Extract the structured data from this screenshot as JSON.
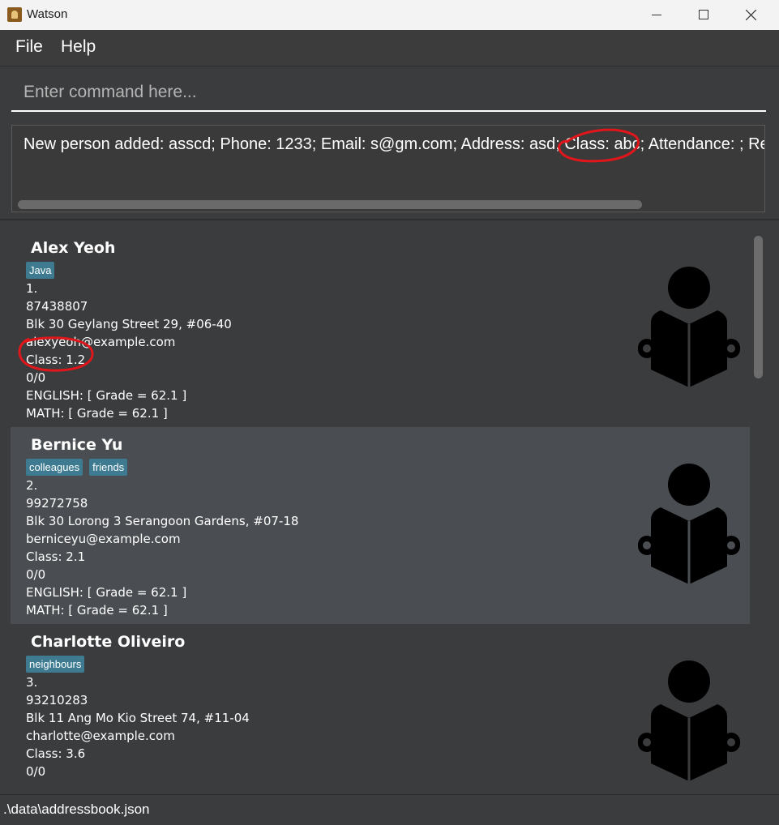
{
  "window": {
    "title": "Watson"
  },
  "menu": {
    "file": "File",
    "help": "Help"
  },
  "command": {
    "placeholder": "Enter command here...",
    "value": ""
  },
  "result": {
    "text": "New person added: asscd; Phone: 1233; Email: s@gm.com; Address: asd; Class: abc; Attendance: ; Remarks"
  },
  "persons": [
    {
      "name": "Alex Yeoh",
      "tags": [
        "Java"
      ],
      "index": "1.",
      "phone": "87438807",
      "address": "Blk 30 Geylang Street 29, #06-40",
      "email": "alexyeoh@example.com",
      "class": "Class: 1.2",
      "attendance": "0/0",
      "grades": [
        "ENGLISH: [ Grade = 62.1 ]",
        "MATH: [ Grade = 62.1 ]"
      ]
    },
    {
      "name": "Bernice Yu",
      "tags": [
        "colleagues",
        "friends"
      ],
      "index": "2.",
      "phone": "99272758",
      "address": "Blk 30 Lorong 3 Serangoon Gardens, #07-18",
      "email": "berniceyu@example.com",
      "class": "Class: 2.1",
      "attendance": "0/0",
      "grades": [
        "ENGLISH: [ Grade = 62.1 ]",
        "MATH: [ Grade = 62.1 ]"
      ]
    },
    {
      "name": "Charlotte Oliveiro",
      "tags": [
        "neighbours"
      ],
      "index": "3.",
      "phone": "93210283",
      "address": "Blk 11 Ang Mo Kio Street 74, #11-04",
      "email": "charlotte@example.com",
      "class": "Class: 3.6",
      "attendance": "0/0",
      "grades": []
    }
  ],
  "status": {
    "path": ".\\data\\addressbook.json"
  },
  "colors": {
    "tag": "#3e7b91",
    "background": "#3b3c3e",
    "selected_card": "#4a4e52",
    "annotation": "#e0161b"
  },
  "icons": {
    "person": "reading-person-icon"
  }
}
